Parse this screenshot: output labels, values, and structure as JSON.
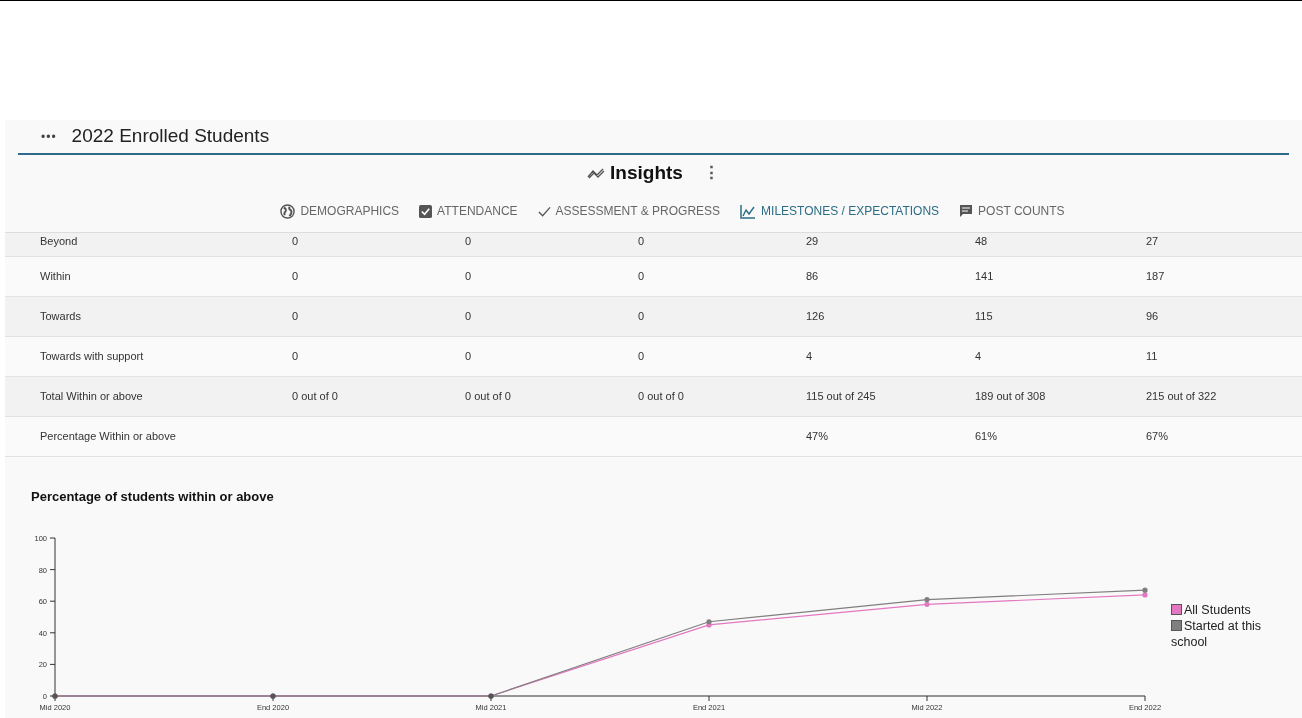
{
  "header": {
    "menu_icon": "•••",
    "title": "2022 Enrolled Students"
  },
  "insights": {
    "title": "Insights",
    "more": "⋮"
  },
  "tabs": [
    {
      "label": "DEMOGRAPHICS",
      "selected": false
    },
    {
      "label": "ATTENDANCE",
      "selected": false
    },
    {
      "label": "ASSESSMENT & PROGRESS",
      "selected": false
    },
    {
      "label": "MILESTONES / EXPECTATIONS",
      "selected": true
    },
    {
      "label": "POST COUNTS",
      "selected": false
    }
  ],
  "table": {
    "rows": [
      {
        "cells": [
          "Beyond",
          "0",
          "0",
          "0",
          "29",
          "48",
          "27"
        ]
      },
      {
        "cells": [
          "Within",
          "0",
          "0",
          "0",
          "86",
          "141",
          "187"
        ]
      },
      {
        "cells": [
          "Towards",
          "0",
          "0",
          "0",
          "126",
          "115",
          "96"
        ]
      },
      {
        "cells": [
          "Towards with support",
          "0",
          "0",
          "0",
          "4",
          "4",
          "11"
        ]
      },
      {
        "cells": [
          "Total Within or above",
          "0 out of 0",
          "0 out of 0",
          "0 out of 0",
          "115 out of 245",
          "189 out of 308",
          "215 out of 322"
        ]
      },
      {
        "cells": [
          "Percentage Within or above",
          "",
          "",
          "",
          "47%",
          "61%",
          "67%"
        ]
      }
    ]
  },
  "chart": {
    "title": "Percentage of students within or above",
    "chart_data": {
      "type": "line",
      "categories": [
        "Mid 2020",
        "End 2020",
        "Mid 2021",
        "End 2021",
        "Mid 2022",
        "End 2022"
      ],
      "ylim": [
        0,
        100
      ],
      "yticks": [
        0,
        20,
        40,
        60,
        80,
        100
      ],
      "series": [
        {
          "name": "All Students",
          "color": "#e377c2",
          "values": [
            0,
            0,
            0,
            45,
            58,
            64
          ]
        },
        {
          "name": "Started at this school",
          "color": "#7f7f7f",
          "values": [
            0,
            0,
            0,
            47,
            61,
            67
          ]
        }
      ]
    }
  }
}
